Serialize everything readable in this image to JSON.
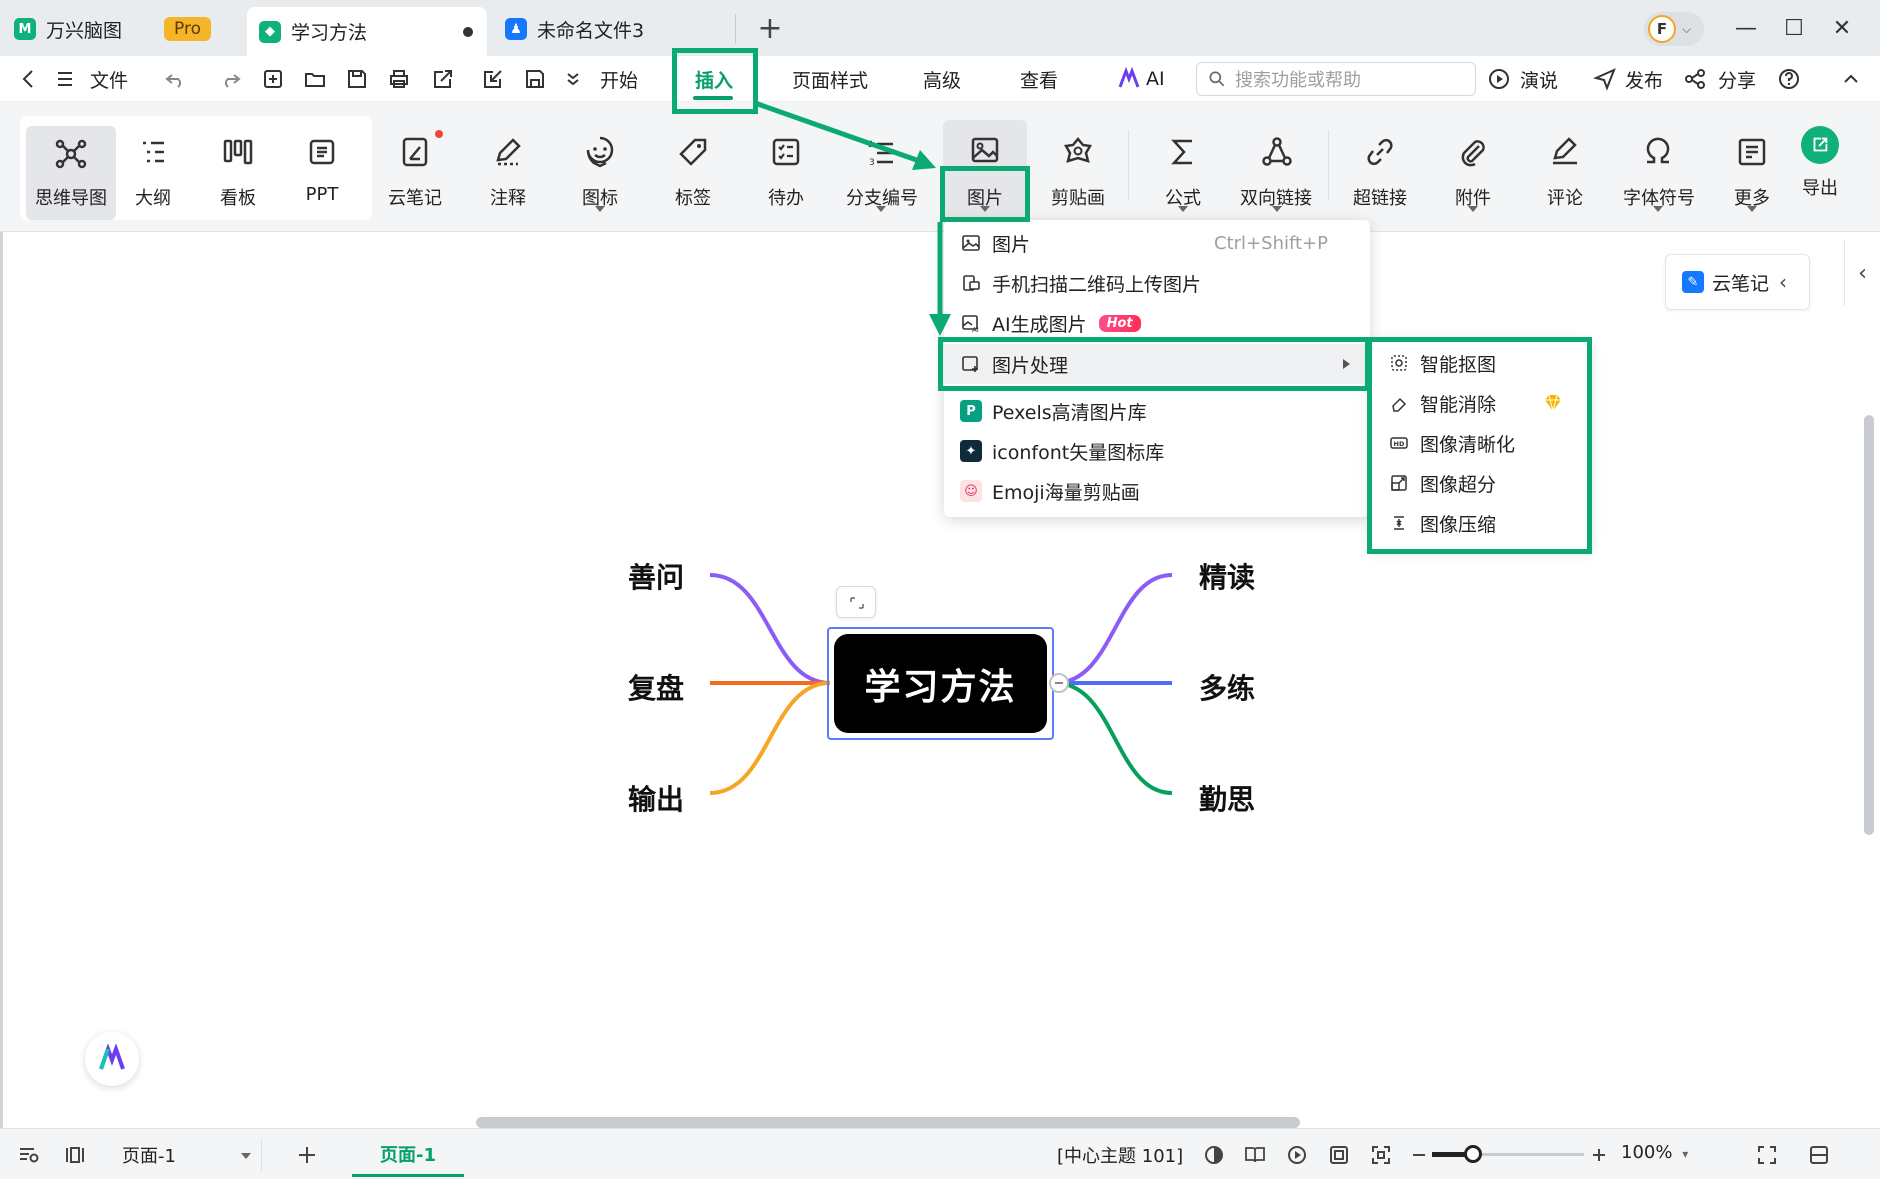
{
  "tabs": {
    "app": {
      "label": "万兴脑图",
      "badge": "Pro"
    },
    "doc1": {
      "label": "学习方法"
    },
    "doc2": {
      "label": "未命名文件3"
    },
    "avatar_initial": "F"
  },
  "menubar": {
    "file": "文件",
    "start": "开始",
    "insert": "插入",
    "page_style": "页面样式",
    "advanced": "高级",
    "view": "查看",
    "ai": "AI",
    "search_placeholder": "搜索功能或帮助",
    "present": "演说",
    "publish": "发布",
    "share": "分享"
  },
  "ribbon": {
    "mindmap": "思维导图",
    "outline": "大纲",
    "kanban": "看板",
    "ppt": "PPT",
    "cloud_note": "云笔记",
    "annotation": "注释",
    "icon": "图标",
    "tag": "标签",
    "todo": "待办",
    "numbering": "分支编号",
    "image": "图片",
    "clipart": "剪贴画",
    "formula": "公式",
    "bilink": "双向链接",
    "hyperlink": "超链接",
    "attachment": "附件",
    "comment": "评论",
    "symbol": "字体符号",
    "more": "更多",
    "export": "导出"
  },
  "image_menu": {
    "image": "图片",
    "image_shortcut": "Ctrl+Shift+P",
    "qr_upload": "手机扫描二维码上传图片",
    "ai_generate": "AI生成图片",
    "hot": "Hot",
    "processing": "图片处理",
    "pexels": "Pexels高清图片库",
    "iconfont": "iconfont矢量图标库",
    "emoji": "Emoji海量剪贴画"
  },
  "sub_menu": {
    "smart_cutout": "智能抠图",
    "smart_erase": "智能消除",
    "enhance": "图像清晰化",
    "super_res": "图像超分",
    "compress": "图像压缩"
  },
  "canvas": {
    "cloud_note_panel": "云笔记",
    "central_topic": "学习方法",
    "branches": {
      "left": [
        "善问",
        "复盘",
        "输出"
      ],
      "right": [
        "精读",
        "多练",
        "勤思"
      ]
    }
  },
  "status": {
    "page_select": "页面-1",
    "page_tab": "页面-1",
    "topic_info": "[中心主题 101]",
    "zoom": "100%"
  },
  "colors": {
    "accent": "#07a06a",
    "highlight": "#0caa73",
    "branch_shanwen": "#8b5cf6",
    "branch_fupan": "#f26b21",
    "branch_shuchu": "#f5a623",
    "branch_jingdu": "#8b5cf6",
    "branch_duolian": "#4f6ef7",
    "branch_qinsi": "#07a05a"
  }
}
